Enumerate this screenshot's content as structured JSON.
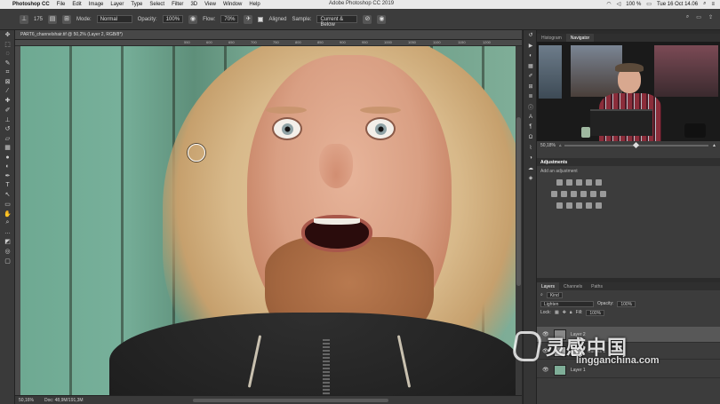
{
  "menubar": {
    "app_name": "Photoshop CC",
    "items": [
      "File",
      "Edit",
      "Image",
      "Layer",
      "Type",
      "Select",
      "Filter",
      "3D",
      "View",
      "Window",
      "Help"
    ],
    "window_title": "Adobe Photoshop CC 2019",
    "battery": "100 %",
    "clock": "Tue 16 Oct 14.06"
  },
  "options": {
    "brush_size": "175",
    "mode_label": "Mode:",
    "mode_value": "Normal",
    "opacity_label": "Opacity:",
    "opacity_value": "100%",
    "flow_label": "Flow:",
    "flow_value": "70%",
    "aligned_label": "Aligned",
    "sample_label": "Sample:",
    "sample_value": "Current & Below"
  },
  "document": {
    "tab_title": "PART6_channelshair.tif @ 50,2% (Layer 2, RGB/8*)",
    "ruler_ticks": [
      "550",
      "600",
      "650",
      "700",
      "750",
      "800",
      "850",
      "900",
      "950",
      "1000",
      "1050",
      "1100",
      "1150",
      "1200"
    ],
    "zoom": "50,16%",
    "doc_size": "Doc: 48,9M/191,3M"
  },
  "navigator": {
    "tabs": [
      "Histogram",
      "Navigator"
    ],
    "active_tab": "Navigator",
    "zoom": "50,18%"
  },
  "adjustments": {
    "title": "Adjustments",
    "subtitle": "Add an adjustment"
  },
  "layers": {
    "tabs": [
      "Layers",
      "Channels",
      "Paths"
    ],
    "active_tab": "Layers",
    "filter_label": "Kind",
    "blend_mode": "Lighten",
    "opacity_label": "Opacity:",
    "opacity_value": "100%",
    "lock_label": "Lock:",
    "fill_label": "Fill:",
    "fill_value": "100%",
    "items": [
      {
        "name": "Layer 2"
      },
      {
        "name": "Curves 1"
      },
      {
        "name": "Layer 1"
      }
    ]
  },
  "watermark": {
    "brand": "灵感中国",
    "url": "lingganchina.com"
  },
  "colors": {
    "panel_bg": "#3c3c3c",
    "selected_layer": "#585858"
  }
}
